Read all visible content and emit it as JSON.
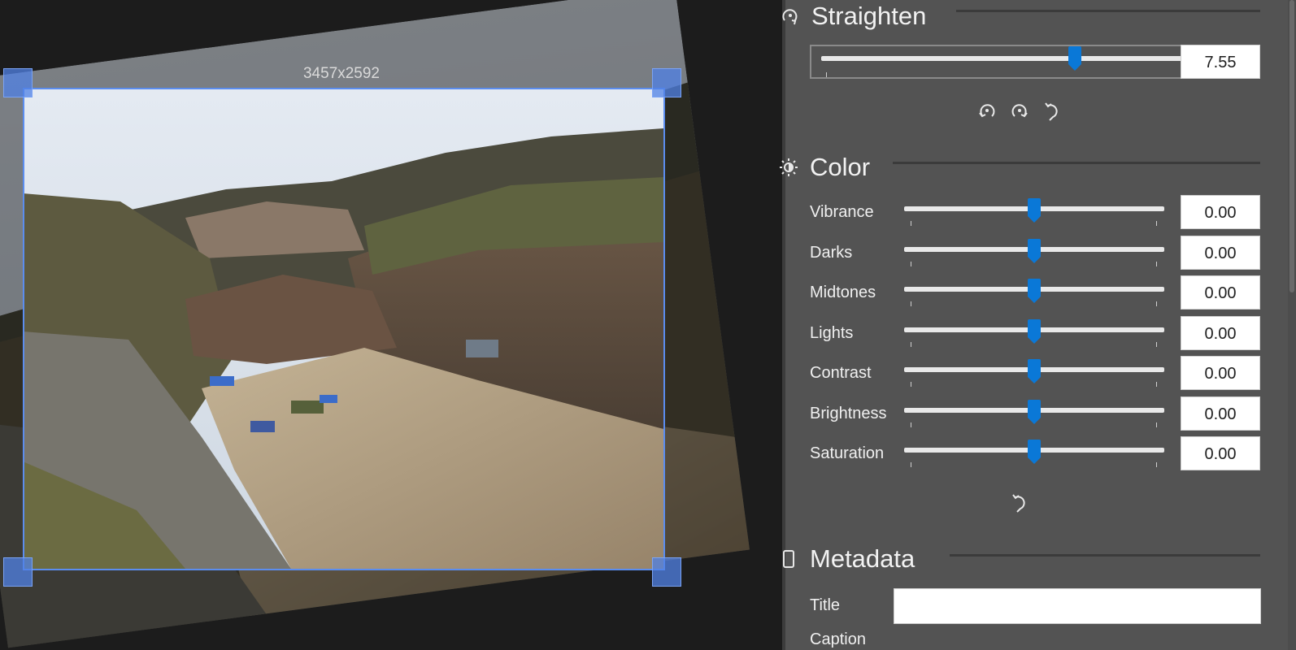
{
  "canvas": {
    "dimensions_label": "3457x2592",
    "rotation_degrees": 7.55
  },
  "panel": {
    "straighten": {
      "title": "Straighten",
      "icon": "rotate-icon",
      "value": "7.55",
      "slider_fraction": 0.676,
      "buttons": [
        {
          "name": "rotate-left-button",
          "icon": "rotate-ccw-icon"
        },
        {
          "name": "rotate-right-button",
          "icon": "rotate-cw-icon"
        },
        {
          "name": "reset-straighten-button",
          "icon": "undo-icon"
        }
      ]
    },
    "color": {
      "title": "Color",
      "icon": "brightness-icon",
      "sliders": [
        {
          "label": "Vibrance",
          "value": "0.00",
          "fraction": 0.5
        },
        {
          "label": "Darks",
          "value": "0.00",
          "fraction": 0.5
        },
        {
          "label": "Midtones",
          "value": "0.00",
          "fraction": 0.5
        },
        {
          "label": "Lights",
          "value": "0.00",
          "fraction": 0.5
        },
        {
          "label": "Contrast",
          "value": "0.00",
          "fraction": 0.5
        },
        {
          "label": "Brightness",
          "value": "0.00",
          "fraction": 0.5
        },
        {
          "label": "Saturation",
          "value": "0.00",
          "fraction": 0.5
        }
      ],
      "reset_icon": "undo-icon"
    },
    "metadata": {
      "title": "Metadata",
      "icon": "tablet-icon",
      "fields": [
        {
          "label": "Title",
          "value": ""
        },
        {
          "label": "Caption",
          "value": ""
        }
      ]
    }
  },
  "colors": {
    "accent": "#0a78d7",
    "crop_frame": "#5b8def",
    "panel_bg": "#535353",
    "canvas_bg": "#1c1c1c"
  }
}
